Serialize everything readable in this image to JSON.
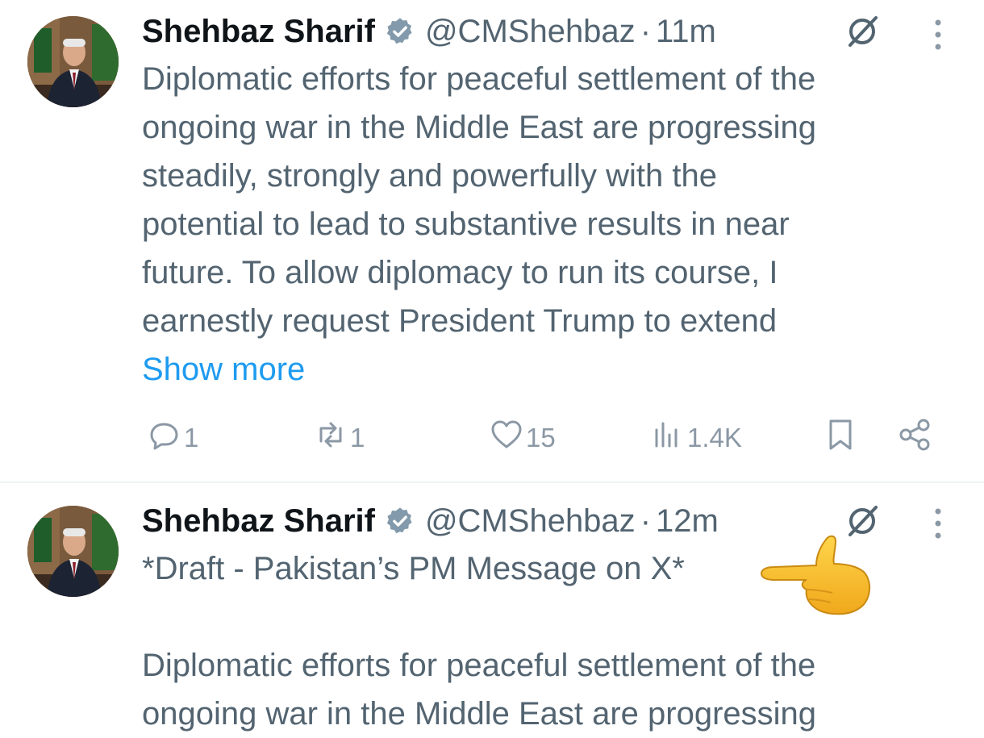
{
  "tweets": [
    {
      "author": "Shehbaz Sharif",
      "handle": "@CMShehbaz",
      "separator": "·",
      "time": "11m",
      "body_lines": [
        "Diplomatic efforts for peaceful settlement of the",
        "ongoing war in the Middle East are progressing",
        "steadily, strongly and powerfully with the",
        "potential to lead to substantive results in near",
        "future. To allow diplomacy to run its course, I",
        "earnestly request President Trump to extend"
      ],
      "show_more": "Show more",
      "replies": "1",
      "reposts": "1",
      "likes": "15",
      "views": "1.4K"
    },
    {
      "author": "Shehbaz Sharif",
      "handle": "@CMShehbaz",
      "separator": "·",
      "time": "12m",
      "draft_line": "*Draft - Pakistan’s PM Message on X*",
      "body_lines": [
        "Diplomatic efforts for peaceful settlement of the",
        "ongoing war in the Middle East are progressing"
      ]
    }
  ],
  "colors": {
    "text_primary": "#0f1419",
    "text_secondary": "#536471",
    "link": "#1d9bf0",
    "icon_muted": "#8b98a5",
    "divider": "#eff3f4"
  },
  "icons": {
    "verified": "verified-badge-icon",
    "grok": "grok-icon",
    "more": "more-options-icon",
    "reply": "reply-icon",
    "repost": "repost-icon",
    "like": "heart-icon",
    "views": "views-icon",
    "bookmark": "bookmark-icon",
    "share": "share-icon",
    "annotation": "pointing-hand-emoji"
  }
}
